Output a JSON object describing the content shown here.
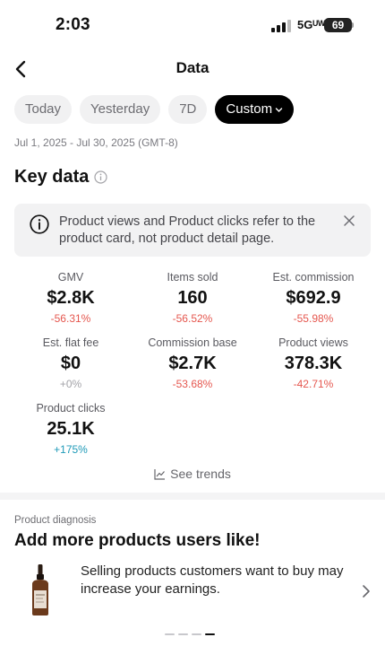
{
  "status": {
    "time": "2:03",
    "network": "5Gᵁᵂ",
    "battery": "69"
  },
  "nav": {
    "title": "Data"
  },
  "chips": [
    "Today",
    "Yesterday",
    "7D",
    "Custom"
  ],
  "date_range": "Jul 1, 2025 - Jul 30, 2025 (GMT-8)",
  "key_data": {
    "title": "Key data",
    "notice": "Product views and Product clicks refer to the product card, not product detail page."
  },
  "metrics": [
    {
      "label": "GMV",
      "value": "$2.8K",
      "change": "-56.31%",
      "trend": "neg"
    },
    {
      "label": "Items sold",
      "value": "160",
      "change": "-56.52%",
      "trend": "neg"
    },
    {
      "label": "Est. commission",
      "value": "$692.9",
      "change": "-55.98%",
      "trend": "neg"
    },
    {
      "label": "Est. flat fee",
      "value": "$0",
      "change": "+0%",
      "trend": "neutral"
    },
    {
      "label": "Commission base",
      "value": "$2.7K",
      "change": "-53.68%",
      "trend": "neg"
    },
    {
      "label": "Product views",
      "value": "378.3K",
      "change": "-42.71%",
      "trend": "neg"
    },
    {
      "label": "Product clicks",
      "value": "25.1K",
      "change": "+175%",
      "trend": "pos"
    }
  ],
  "see_trends": "See trends",
  "diagnosis": {
    "label": "Product diagnosis",
    "title": "Add more products users like!",
    "text": "Selling products customers want to buy may increase your earnings."
  },
  "colors": {
    "negative": "#e5574f",
    "positive": "#1f9ab8",
    "active_chip": "#000000"
  },
  "pager": {
    "count": 4,
    "active": 3
  }
}
